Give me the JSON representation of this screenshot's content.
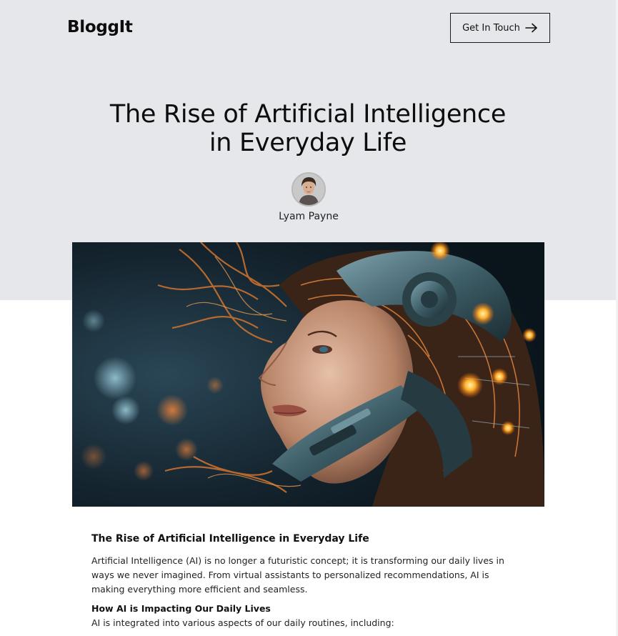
{
  "header": {
    "logo": "BloggIt",
    "cta_label": "Get In Touch"
  },
  "hero": {
    "title": "The Rise of Artificial Intelligence in Everyday Life",
    "author": "Lyam Payne"
  },
  "article": {
    "heading": "The Rise of Artificial Intelligence in Everyday Life",
    "intro": "Artificial Intelligence (AI) is no longer a futuristic concept; it is transforming our daily lives in ways we never imagined. From virtual assistants to personalized recommendations, AI is making everything more efficient and seamless.",
    "subheading": "How AI is Impacting Our Daily Lives",
    "subtext": "AI is integrated into various aspects of our daily routines, including:"
  },
  "colors": {
    "hero_background": "#e6e7ea",
    "text": "#111111",
    "border": "#1a1a1a"
  },
  "icons": {
    "cta": "arrow-right-icon"
  }
}
